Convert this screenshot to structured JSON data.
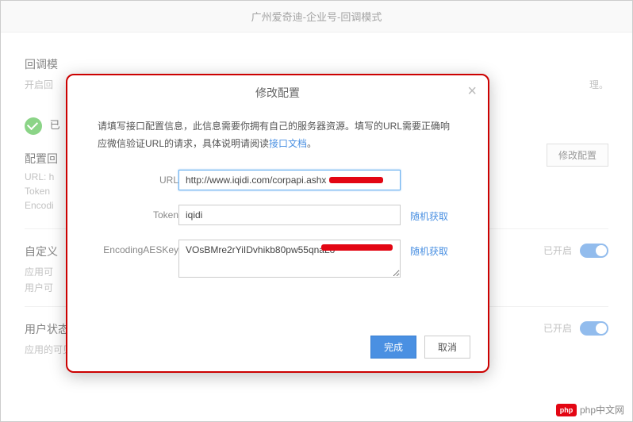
{
  "page": {
    "header_title": "广州爱奇迪-企业号-回调模式"
  },
  "sections": {
    "callback": {
      "title_partial": "回调模",
      "desc_partial": "开启回",
      "desc_tail": "理。",
      "enabled_badge_partial": "已",
      "edit_button": "修改配置",
      "config_title_partial": "配置回",
      "url_label": "URL: h",
      "token_label": "Token",
      "aeskey_label": "Encodi"
    },
    "custom": {
      "title_partial": "自定义",
      "desc1_partial": "应用可",
      "desc2_partial": "用户可",
      "status_text": "已开启"
    },
    "user_change": {
      "title": "用户状态变更通知",
      "desc": "应用的可见范围中新增了成员，或者减少了成员，通知企业。",
      "status_text": "已开启"
    }
  },
  "modal": {
    "title": "修改配置",
    "tip_part1": "请填写接口配置信息，此信息需要你拥有自己的服务器资源。填写的URL需要正确响应微信验证URL的请求，具体说明请阅读",
    "tip_link": "接口文档",
    "tip_tail": "。",
    "labels": {
      "url": "URL",
      "token": "Token",
      "aeskey": "EncodingAESKey"
    },
    "values": {
      "url": "http://www.iqidi.com/corpapi.ashx",
      "token": "iqidi",
      "aeskey": "VOsBMre2rYiIDvhikb80pw55qnaLo"
    },
    "random_link": "随机获取",
    "btn_ok": "完成",
    "btn_cancel": "取消"
  },
  "watermark": {
    "logo": "php",
    "text": "php中文网"
  }
}
